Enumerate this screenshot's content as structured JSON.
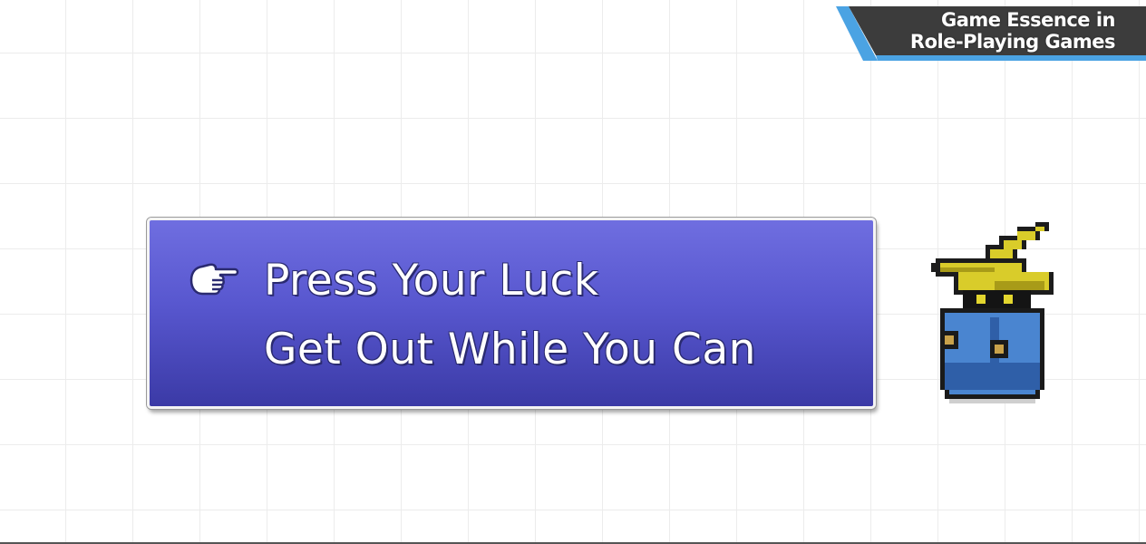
{
  "overlay": {
    "title_line_1": "Game Essence in",
    "title_line_2": "Role-Playing Games",
    "badge_color": "#3c3c3c",
    "badge_accent_color": "#4ba3e3"
  },
  "command_menu": {
    "cursor_icon": "pointing-hand-icon",
    "window_color": "#5a59d0",
    "options": [
      {
        "label": "Press Your Luck",
        "selected": true
      },
      {
        "label": "Get Out While You Can",
        "selected": false
      }
    ]
  },
  "character": {
    "sprite": "black-mage-sprite"
  }
}
